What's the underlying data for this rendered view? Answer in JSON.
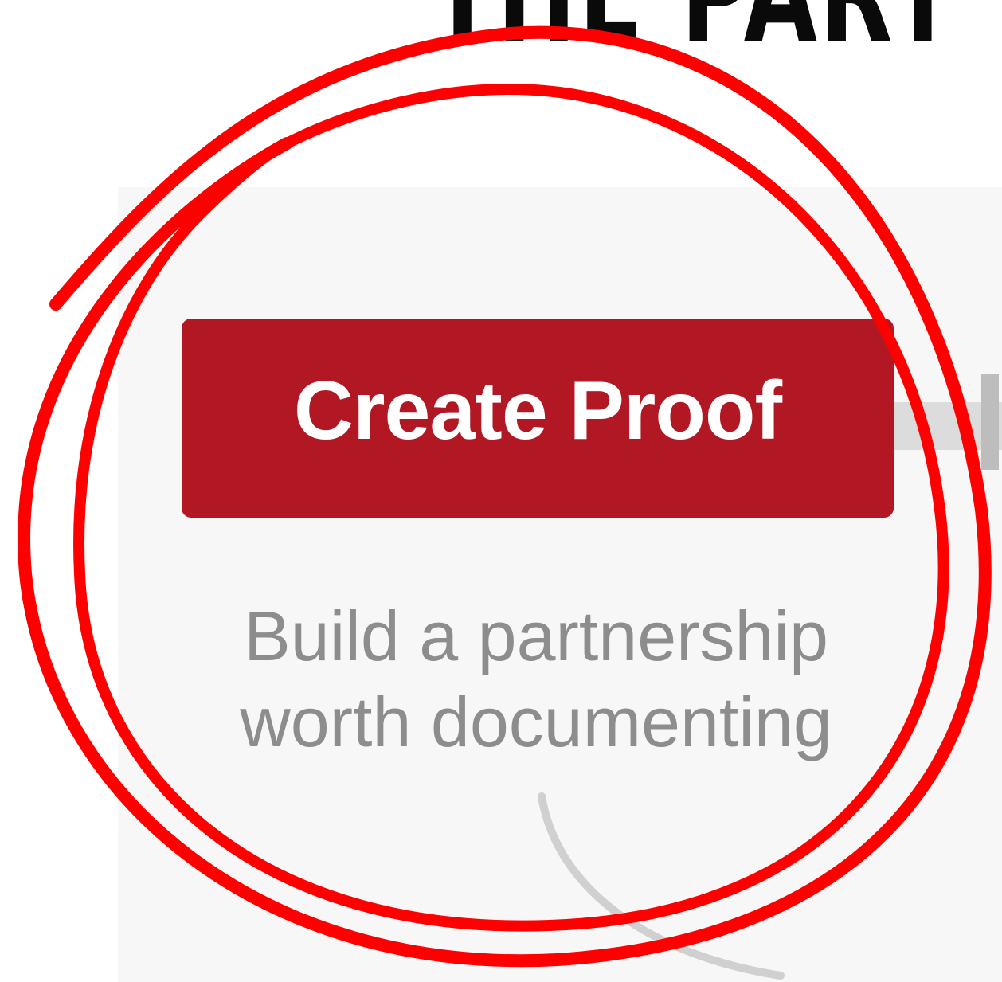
{
  "heading": {
    "text": "THE PART"
  },
  "button": {
    "label": "Create Proof",
    "color": "#b21823"
  },
  "subtitle": {
    "line1": "Build a partnership",
    "line2": "worth documenting"
  },
  "annotation": {
    "color": "#ff0000",
    "shape": "hand-drawn circle"
  }
}
